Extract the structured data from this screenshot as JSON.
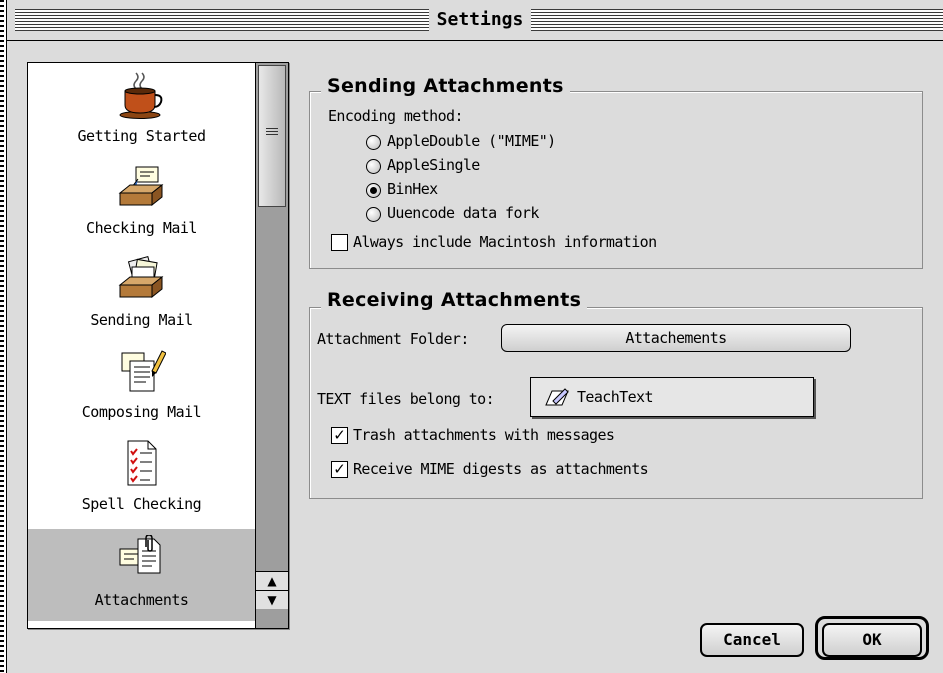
{
  "window": {
    "title": "Settings"
  },
  "sidebar": {
    "items": [
      {
        "label": "Getting Started",
        "icon": "coffee-cup-icon"
      },
      {
        "label": "Checking Mail",
        "icon": "inbox-tray-icon"
      },
      {
        "label": "Sending Mail",
        "icon": "outbox-tray-icon"
      },
      {
        "label": "Composing Mail",
        "icon": "document-pencil-icon"
      },
      {
        "label": "Spell Checking",
        "icon": "checklist-icon"
      },
      {
        "label": "Attachments",
        "icon": "paperclip-document-icon",
        "selected": true
      }
    ]
  },
  "sending": {
    "title": "Sending Attachments",
    "encoding_label": "Encoding method:",
    "options": [
      {
        "label": "AppleDouble (\"MIME\")",
        "selected": false
      },
      {
        "label": "AppleSingle",
        "selected": false
      },
      {
        "label": "BinHex",
        "selected": true
      },
      {
        "label": "Uuencode data fork",
        "selected": false
      }
    ],
    "mac_info_label": "Always include Macintosh information",
    "mac_info_checked": false
  },
  "receiving": {
    "title": "Receiving Attachments",
    "folder_label": "Attachment Folder:",
    "folder_value": "Attachements",
    "text_files_label": "TEXT files belong to:",
    "text_files_app": "TeachText",
    "trash_label": "Trash attachments with messages",
    "trash_checked": true,
    "mime_label": "Receive MIME digests as attachments",
    "mime_checked": true
  },
  "buttons": {
    "cancel": "Cancel",
    "ok": "OK"
  }
}
